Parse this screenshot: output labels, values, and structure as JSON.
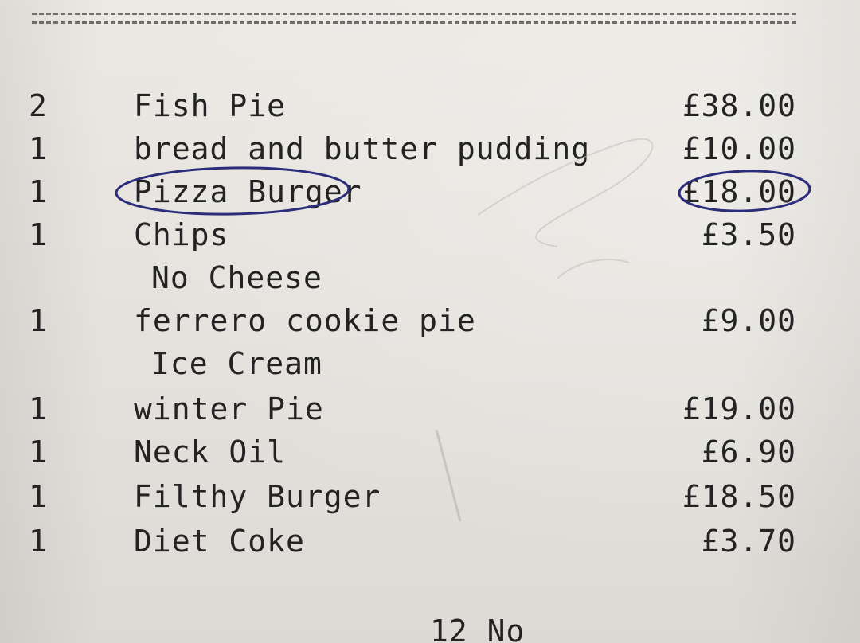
{
  "colors": {
    "paper": "#e7e4df",
    "ink": "#232323",
    "pen": "#2b2c7a"
  },
  "items": [
    {
      "qty": "2",
      "name": "Fish Pie",
      "price": "£38.00"
    },
    {
      "qty": "1",
      "name": "bread and butter pudding",
      "price": "£10.00"
    },
    {
      "qty": "1",
      "name": "Pizza Burger",
      "price": "£18.00",
      "circled": true
    },
    {
      "qty": "1",
      "name": "Chips",
      "price": "£3.50"
    },
    {
      "modifier": "No Cheese"
    },
    {
      "qty": "1",
      "name": "ferrero cookie pie",
      "price": "£9.00"
    },
    {
      "modifier": "Ice Cream"
    },
    {
      "qty": "1",
      "name": "winter Pie",
      "price": "£19.00"
    },
    {
      "qty": "1",
      "name": "Neck Oil",
      "price": "£6.90"
    },
    {
      "qty": "1",
      "name": "Filthy Burger",
      "price": "£18.50"
    },
    {
      "qty": "1",
      "name": "Diet Coke",
      "price": "£3.70"
    }
  ],
  "footer_text": "12 No"
}
